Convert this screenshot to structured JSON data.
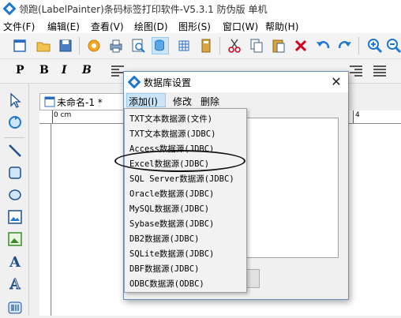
{
  "window": {
    "title": "领跑(LabelPainter)条码标签打印软件-V5.3.1 防伪版 单机"
  },
  "menubar": {
    "items": [
      {
        "label": "文件(F)"
      },
      {
        "label": "编辑(E)"
      },
      {
        "label": "查看(V)"
      },
      {
        "label": "绘图(D)"
      },
      {
        "label": "图形(S)"
      },
      {
        "label": "窗口(W)"
      },
      {
        "label": "帮助(H)"
      }
    ]
  },
  "format_toolbar": {
    "paragraph": "P",
    "bold": "B",
    "italic": "I",
    "bold_italic": "B"
  },
  "document": {
    "tab_label": "未命名-1 *",
    "ruler_origin": "0 cm",
    "ruler_mark": "4"
  },
  "toolbox": {
    "text_tool": "A",
    "outline_text_tool": "A"
  },
  "dialog": {
    "title": "数据库设置",
    "close_glyph": "✕",
    "menu": {
      "add": "添加(I)",
      "edit": "修改",
      "delete": "删除"
    }
  },
  "dropdown": {
    "items": [
      {
        "label": "TXT文本数据源(文件)"
      },
      {
        "label": "TXT文本数据源(JDBC)"
      },
      {
        "label": "Access数据源(JDBC)"
      },
      {
        "label": "Excel数据源(JDBC)"
      },
      {
        "label": "SQL Server数据源(JDBC)"
      },
      {
        "label": "Oracle数据源(JDBC)"
      },
      {
        "label": "MySQL数据源(JDBC)"
      },
      {
        "label": "Sybase数据源(JDBC)"
      },
      {
        "label": "DB2数据源(JDBC)"
      },
      {
        "label": "SQLite数据源(JDBC)"
      },
      {
        "label": "DBF数据源(JDBC)"
      },
      {
        "label": "ODBC数据源(ODBC)"
      }
    ],
    "highlighted": "Excel数据源(JDBC)"
  },
  "colors": {
    "accent": "#1e78d2",
    "menu_highlight": "#cce4f7"
  }
}
